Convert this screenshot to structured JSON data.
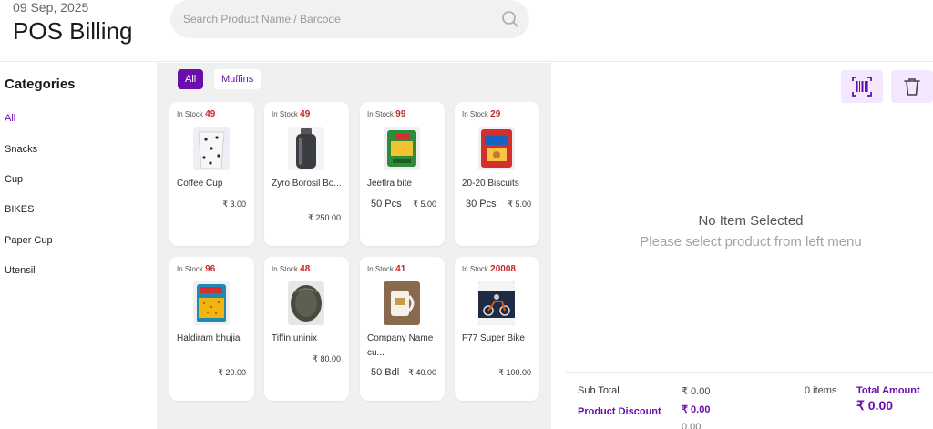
{
  "header": {
    "date": "09 Sep, 2025",
    "title": "POS Billing",
    "search_placeholder": "Search Product Name / Barcode"
  },
  "sidebar": {
    "title": "Categories",
    "items": [
      {
        "label": "All",
        "active": true
      },
      {
        "label": "Snacks"
      },
      {
        "label": "Cup"
      },
      {
        "label": "BIKES"
      },
      {
        "label": "Paper Cup"
      },
      {
        "label": "Utensil"
      }
    ]
  },
  "filters": [
    "All",
    "Muffins"
  ],
  "stock_label": "In Stock",
  "products": [
    {
      "stock": "49",
      "name": "Coffee Cup",
      "unit": "",
      "price": "₹ 3.00",
      "icon": "coffee-cup-image"
    },
    {
      "stock": "49",
      "name": "Zyro Borosil Bo...",
      "unit": "",
      "price": "₹ 250.00",
      "icon": "bottle-image"
    },
    {
      "stock": "99",
      "name": "Jeetlra bite",
      "unit": "50 Pcs",
      "price": "₹ 5.00",
      "icon": "snack-pack-image"
    },
    {
      "stock": "29",
      "name": "20-20 Biscuits",
      "unit": "30 Pcs",
      "price": "₹ 5.00",
      "icon": "biscuit-pack-image"
    },
    {
      "stock": "96",
      "name": "Haldiram bhujia",
      "unit": "",
      "price": "₹ 20.00",
      "icon": "bhujia-pack-image"
    },
    {
      "stock": "48",
      "name": "Tiffin uninix",
      "unit": "",
      "price": "₹ 80.00",
      "icon": "tiffin-image"
    },
    {
      "stock": "41",
      "name": "Company Name cu...",
      "unit": "50 Bdl",
      "price": "₹ 40.00",
      "icon": "mug-image"
    },
    {
      "stock": "20008",
      "name": "F77 Super Bike",
      "unit": "",
      "price": "₹ 100.00",
      "icon": "bike-image"
    }
  ],
  "panel": {
    "empty_title": "No Item Selected",
    "empty_subtitle": "Please select product from left menu",
    "sub_total_label": "Sub Total",
    "sub_total_value": "₹ 0.00",
    "items_count": "0 items",
    "discount_label": "Product Discount",
    "discount_value": "₹ 0.00",
    "extra_value": "0.00",
    "total_label": "Total Amount",
    "total_value": "₹ 0.00"
  },
  "colors": {
    "accent": "#6a0dad",
    "stock_number": "#c62828",
    "tool_button_bg": "#f3e8fd"
  }
}
